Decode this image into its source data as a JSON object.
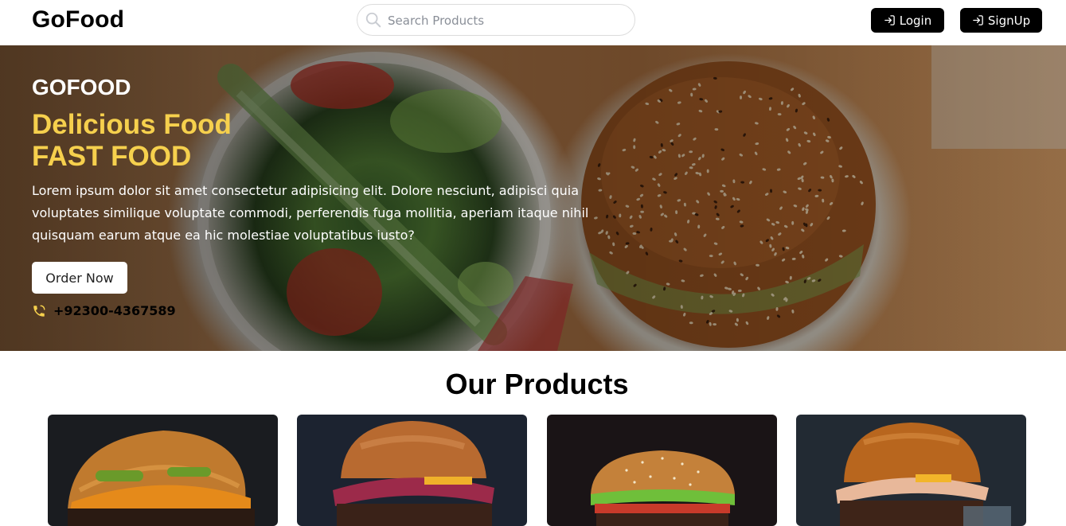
{
  "nav": {
    "brand": "GoFood",
    "search_placeholder": "Search Products",
    "login_label": "Login",
    "signup_label": "SignUp",
    "icons": {
      "search": "search-icon",
      "login": "login-icon",
      "signup": "login-icon"
    }
  },
  "hero": {
    "kicker": "GOFOOD",
    "title_line1": "Delicious Food",
    "title_line2": "FAST FOOD",
    "description": "Lorem ipsum dolor sit amet consectetur adipisicing elit. Dolore nesciunt, adipisci quia voluptates similique voluptate commodi, perferendis fuga mollitia, aperiam itaque nihil quisquam earum atque ea hic molestiae voluptatibus iusto?",
    "order_label": "Order Now",
    "phone": "+92300-4367589",
    "phone_icon": "phone-icon"
  },
  "products": {
    "title": "Our Products",
    "cards": [
      {
        "image": "burger-image"
      },
      {
        "image": "burger-image"
      },
      {
        "image": "burger-image"
      },
      {
        "image": "burger-image"
      }
    ]
  },
  "colors": {
    "accent_yellow": "#f6d04d",
    "button_dark": "#000000",
    "text_white": "#ffffff"
  }
}
